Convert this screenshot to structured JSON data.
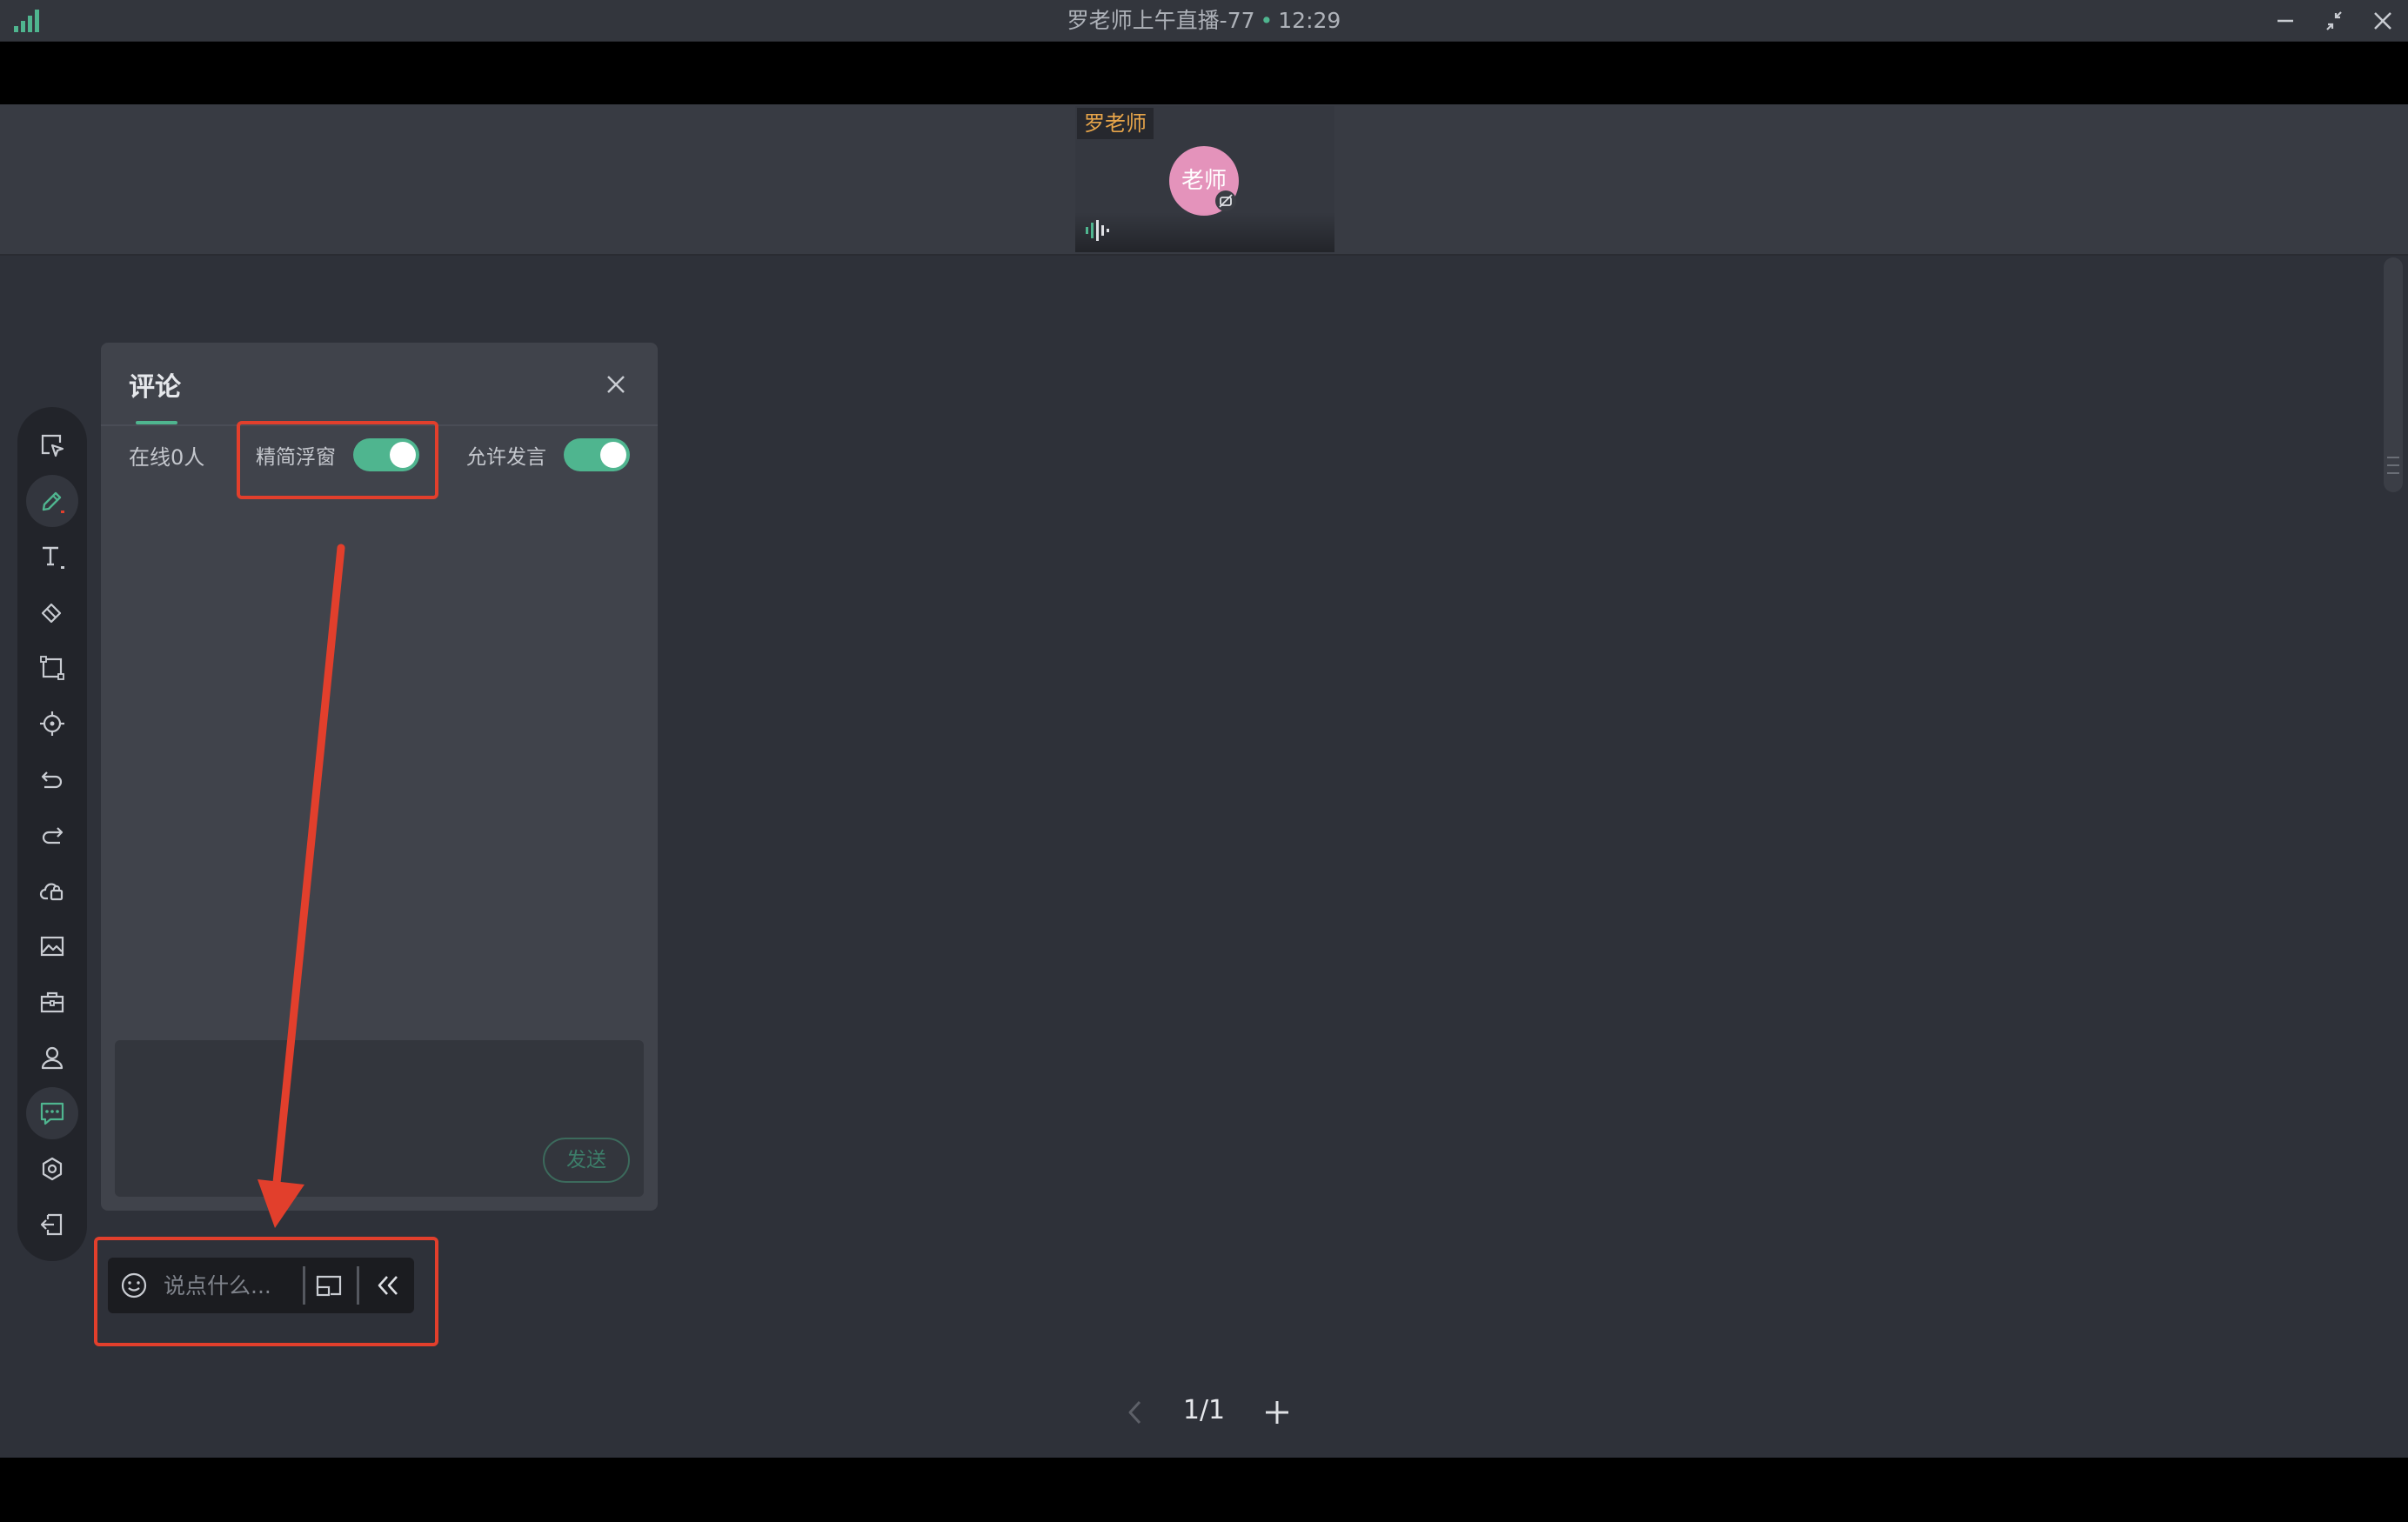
{
  "window": {
    "title": "罗老师上午直播-77",
    "dot": "•",
    "time": "12:29"
  },
  "video": {
    "tile_name": "罗老师",
    "avatar_label": "老师"
  },
  "toolbar": {
    "tools": [
      "select-icon",
      "pen-icon",
      "text-icon",
      "eraser-icon",
      "shape-icon",
      "laser-pointer-icon",
      "undo-icon",
      "redo-icon",
      "cloud-drive-icon",
      "image-icon",
      "toolbox-icon",
      "users-icon",
      "comment-icon",
      "settings-icon",
      "exit-icon"
    ],
    "active": [
      "pen-icon",
      "comment-icon"
    ]
  },
  "comment_panel": {
    "title": "评论",
    "online": "在线0人",
    "simple_float_label": "精简浮窗",
    "simple_float_on": true,
    "allow_speak_label": "允许发言",
    "allow_speak_on": true,
    "send_label": "发送"
  },
  "float_bar": {
    "placeholder": "说点什么..."
  },
  "pagination": {
    "page": "1/1"
  },
  "colors": {
    "accent": "#4fb58f",
    "annotation": "#e23f2c",
    "avatar": "#e493bb",
    "name_tag": "#e7a54a"
  }
}
